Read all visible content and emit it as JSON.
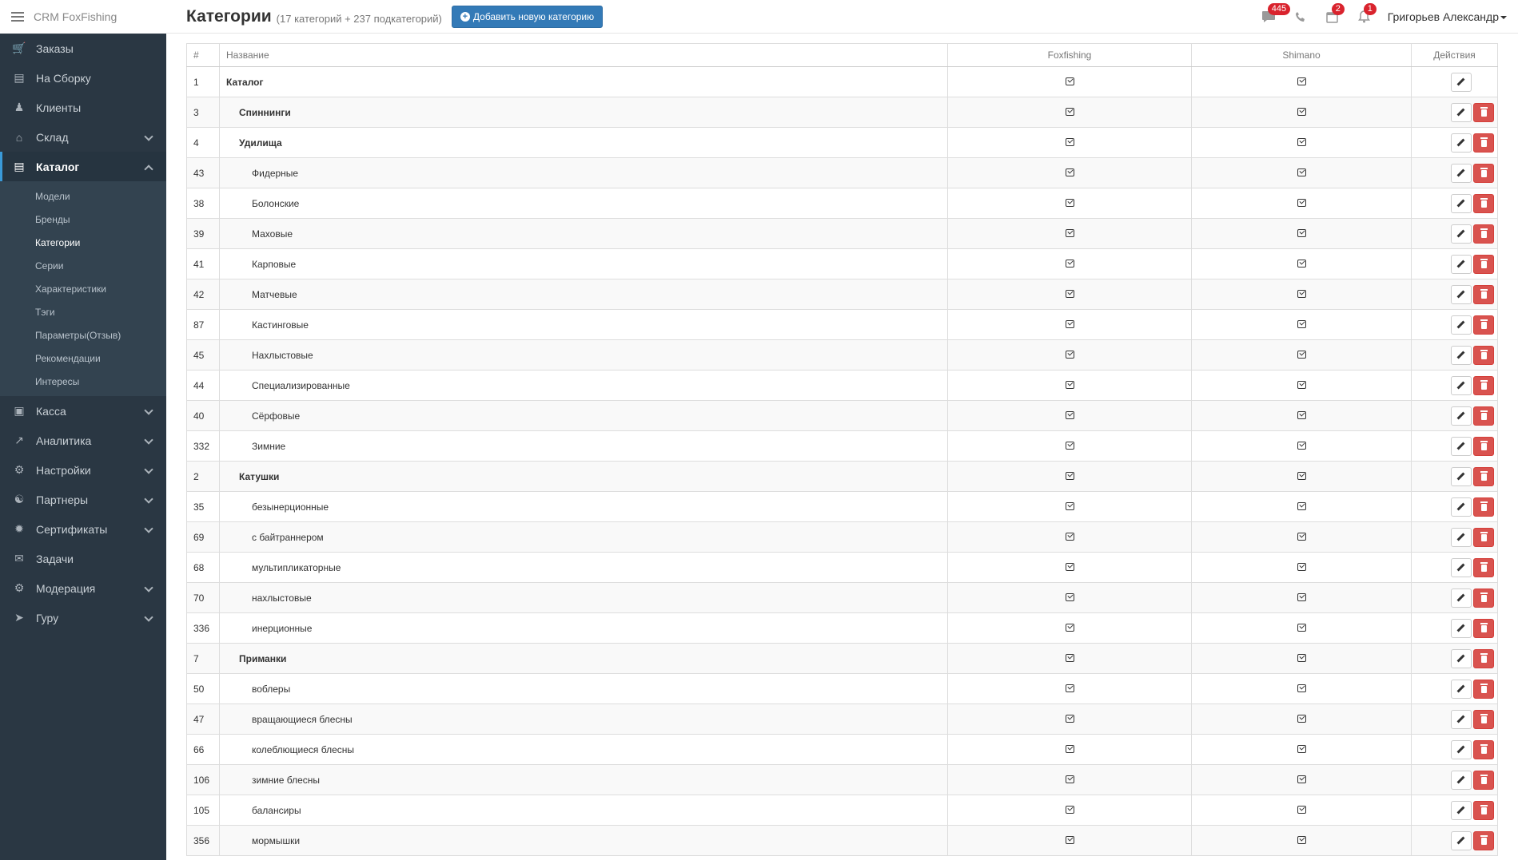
{
  "brand": {
    "title": "CRM FoxFishing"
  },
  "header": {
    "title": "Категории",
    "subtitle": "(17 категорий + 237 подкатегорий)",
    "add_button": "Добавить новую категорию",
    "badges": {
      "messages": "445",
      "calendar": "2",
      "notifications": "1"
    },
    "user": "Григорьев Александр"
  },
  "sidebar": {
    "items_top": [
      {
        "label": "Заказы",
        "icon": "cart-icon"
      },
      {
        "label": "На Сборку",
        "icon": "archive-icon"
      },
      {
        "label": "Клиенты",
        "icon": "users-icon"
      },
      {
        "label": "Склад",
        "icon": "home-icon",
        "expandable": true
      },
      {
        "label": "Каталог",
        "icon": "catalog-icon",
        "expandable": true,
        "expanded": true
      }
    ],
    "catalog_sub": [
      "Модели",
      "Бренды",
      "Категории",
      "Серии",
      "Характеристики",
      "Тэги",
      "Параметры(Отзыв)",
      "Рекомендации",
      "Интересы"
    ],
    "items_bottom": [
      {
        "label": "Касса",
        "icon": "money-icon"
      },
      {
        "label": "Аналитика",
        "icon": "chart-icon"
      },
      {
        "label": "Настройки",
        "icon": "gears-icon"
      },
      {
        "label": "Партнеры",
        "icon": "handshake-icon"
      },
      {
        "label": "Сертификаты",
        "icon": "certificate-icon"
      },
      {
        "label": "Задачи",
        "icon": "ticket-icon",
        "no_chevron": true
      },
      {
        "label": "Модерация",
        "icon": "gears-icon"
      },
      {
        "label": "Гуру",
        "icon": "walk-icon"
      }
    ]
  },
  "table": {
    "headers": {
      "id": "#",
      "name": "Название",
      "col1": "Foxfishing",
      "col2": "Shimano",
      "actions": "Действия"
    },
    "rows": [
      {
        "id": "1",
        "name": "Каталог",
        "level": 0,
        "root": true
      },
      {
        "id": "3",
        "name": "Спиннинги",
        "level": 1
      },
      {
        "id": "4",
        "name": "Удилища",
        "level": 1
      },
      {
        "id": "43",
        "name": "Фидерные",
        "level": 2
      },
      {
        "id": "38",
        "name": "Болонские",
        "level": 2
      },
      {
        "id": "39",
        "name": "Маховые",
        "level": 2
      },
      {
        "id": "41",
        "name": "Карповые",
        "level": 2
      },
      {
        "id": "42",
        "name": "Матчевые",
        "level": 2
      },
      {
        "id": "87",
        "name": "Кастинговые",
        "level": 2
      },
      {
        "id": "45",
        "name": "Нахлыстовые",
        "level": 2
      },
      {
        "id": "44",
        "name": "Специализированные",
        "level": 2
      },
      {
        "id": "40",
        "name": "Сёрфовые",
        "level": 2
      },
      {
        "id": "332",
        "name": "Зимние",
        "level": 2
      },
      {
        "id": "2",
        "name": "Катушки",
        "level": 1
      },
      {
        "id": "35",
        "name": "безынерционные",
        "level": 2
      },
      {
        "id": "69",
        "name": "с байтраннером",
        "level": 2
      },
      {
        "id": "68",
        "name": "мультипликаторные",
        "level": 2
      },
      {
        "id": "70",
        "name": "нахлыстовые",
        "level": 2
      },
      {
        "id": "336",
        "name": "инерционные",
        "level": 2
      },
      {
        "id": "7",
        "name": "Приманки",
        "level": 1
      },
      {
        "id": "50",
        "name": "воблеры",
        "level": 2
      },
      {
        "id": "47",
        "name": "вращающиеся блесны",
        "level": 2
      },
      {
        "id": "66",
        "name": "колеблющиеся блесны",
        "level": 2
      },
      {
        "id": "106",
        "name": "зимние блесны",
        "level": 2
      },
      {
        "id": "105",
        "name": "балансиры",
        "level": 2
      },
      {
        "id": "356",
        "name": "мормышки",
        "level": 2
      }
    ]
  }
}
